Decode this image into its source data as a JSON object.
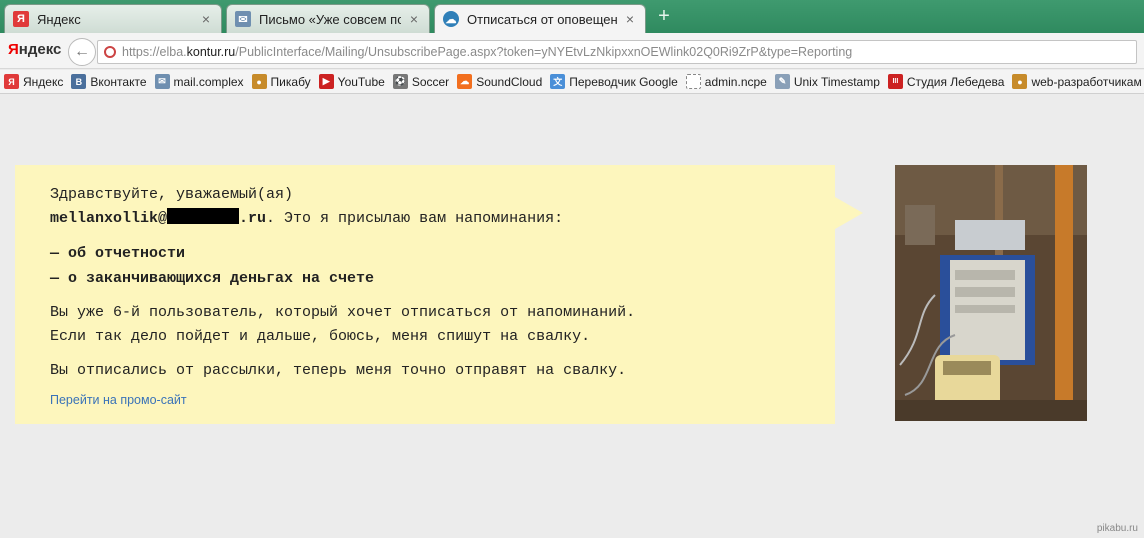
{
  "tabs": [
    {
      "title": "Яндекс",
      "icon": "yandex-icon",
      "close": "×"
    },
    {
      "title": "Письмо «Уже совсем пор…",
      "icon": "mail-icon",
      "close": "×"
    },
    {
      "title": "Отписаться от оповещений",
      "icon": "kontur-cloud-icon",
      "close": "×"
    }
  ],
  "new_tab": "+",
  "toolbar": {
    "brand": "Яндекс",
    "brand_first": "Я",
    "brand_rest": "ндекс",
    "back": "←",
    "url_prefix": "https://elba.",
    "url_domain": "kontur.ru",
    "url_suffix": "/PublicInterface/Mailing/UnsubscribePage.aspx?token=yNYEtvLzNkipxxnOEWlink02Q0Ri9ZrP&type=Reporting"
  },
  "bookmarks": [
    {
      "label": "Яндекс",
      "icon": "yandex-icon",
      "glyph": "Я",
      "color": "#e03a3a"
    },
    {
      "label": "Вконтакте",
      "icon": "vk-icon",
      "glyph": "В",
      "color": "#4a6f9c"
    },
    {
      "label": "mail.complex",
      "icon": "mail-icon",
      "glyph": "✉",
      "color": "#6f8fb0"
    },
    {
      "label": "Пикабу",
      "icon": "pikabu-icon",
      "glyph": "●",
      "color": "#c78b2a"
    },
    {
      "label": "YouTube",
      "icon": "youtube-icon",
      "glyph": "▶",
      "color": "#cc2222"
    },
    {
      "label": "Soccer",
      "icon": "soccer-icon",
      "glyph": "⚽",
      "color": "#777777"
    },
    {
      "label": "SoundCloud",
      "icon": "soundcloud-icon",
      "glyph": "☁",
      "color": "#f26f1f"
    },
    {
      "label": "Переводчик Google",
      "icon": "google-translate-icon",
      "glyph": "文",
      "color": "#4a8fd8"
    },
    {
      "label": "admin.ncpe",
      "icon": "page-icon",
      "glyph": "",
      "color": "#ffffff"
    },
    {
      "label": "Unix Timestamp",
      "icon": "pencil-icon",
      "glyph": "✎",
      "color": "#8aa0b8"
    },
    {
      "label": "Студия Лебедева",
      "icon": "artlebedev-icon",
      "glyph": "III",
      "color": "#cc2222"
    },
    {
      "label": "web-разработчикам",
      "icon": "pikabu-icon",
      "glyph": "●",
      "color": "#c78b2a"
    }
  ],
  "message": {
    "greeting": "Здравствуйте, уважаемый(ая)",
    "email_user": "mellanxollik@",
    "email_tld": ".ru",
    "intro_rest": ". Это я присылаю вам напоминания:",
    "item1": "— об отчетности",
    "item2": "— о заканчивающихся деньгах на счете",
    "para1_line1": "Вы уже 6-й пользователь, который хочет отписаться от напоминаний.",
    "para1_line2": "Если так дело пойдет и дальше, боюсь, меня спишут на свалку.",
    "para2": "Вы отписались от рассылки, теперь меня точно отправят на свалку.",
    "promo_link": "Перейти на промо-сайт"
  },
  "watermark": "pikabu.ru",
  "colors": {
    "tabbar": "#2f8a5f",
    "bubble": "#fdf6bd",
    "link": "#3a73b8"
  }
}
